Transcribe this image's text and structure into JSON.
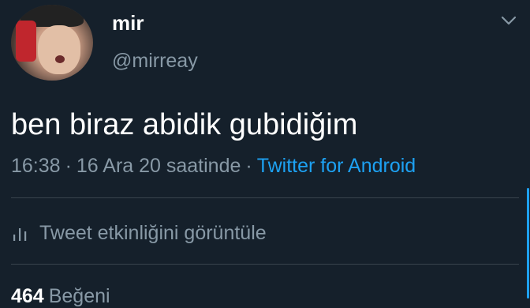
{
  "author": {
    "name": "mir",
    "handle": "@mirreay"
  },
  "tweet": {
    "text": "ben biraz abidik gubidiğim",
    "time": "16:38",
    "separator": "·",
    "date": "16 Ara 20 saatinde",
    "source": "Twitter for Android"
  },
  "activity": {
    "label": "Tweet etkinliğini görüntüle",
    "icon": "bar-chart-icon"
  },
  "stats": {
    "likes_count": "464",
    "likes_label": "Beğeni"
  },
  "colors": {
    "background": "#15202b",
    "text": "#ffffff",
    "secondary": "#8899a6",
    "accent": "#1da1f2",
    "divider": "#38444d"
  }
}
